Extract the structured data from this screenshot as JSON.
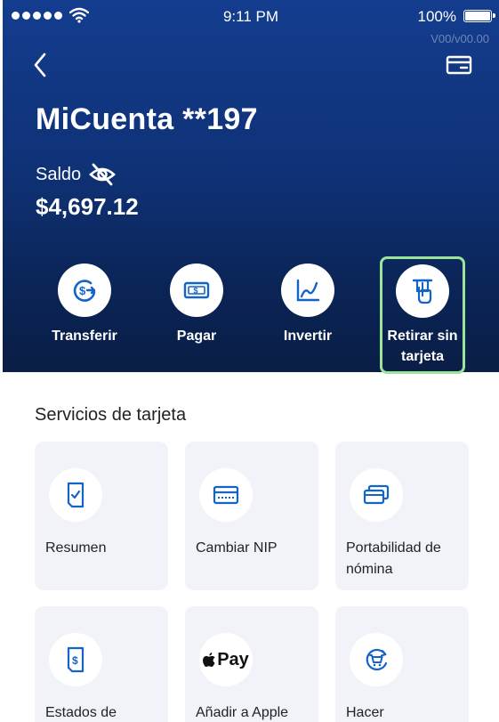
{
  "status_bar": {
    "time": "9:11 PM",
    "battery": "100%",
    "version": "V00/v00.00"
  },
  "header": {
    "account_title": "MiCuenta **197",
    "balance_label": "Saldo",
    "balance_value": "$4,697.12"
  },
  "actions": [
    {
      "label": "Transferir",
      "icon": "transfer-icon"
    },
    {
      "label": "Pagar",
      "icon": "cash-icon"
    },
    {
      "label": "Invertir",
      "icon": "chart-icon"
    },
    {
      "label": "Retirar sin tarjeta",
      "icon": "atm-withdraw-icon"
    }
  ],
  "services": {
    "title": "Servicios de tarjeta",
    "items": [
      {
        "label": "Resumen",
        "icon": "document-check-icon"
      },
      {
        "label": "Cambiar NIP",
        "icon": "card-icon"
      },
      {
        "label": "Portabilidad de nómina",
        "icon": "cards-icon"
      },
      {
        "label": "Estados de",
        "icon": "statement-icon"
      },
      {
        "label": "Añadir a Apple",
        "icon": "apple-pay-icon",
        "icon_text": "Pay"
      },
      {
        "label": "Hacer",
        "icon": "cart-refresh-icon"
      }
    ]
  },
  "colors": {
    "header_top": "#143d8f",
    "header_bottom": "#0a1e46",
    "accent": "#1464c8",
    "highlight_border": "#9be59b",
    "tile_bg": "#f1f3f8"
  }
}
